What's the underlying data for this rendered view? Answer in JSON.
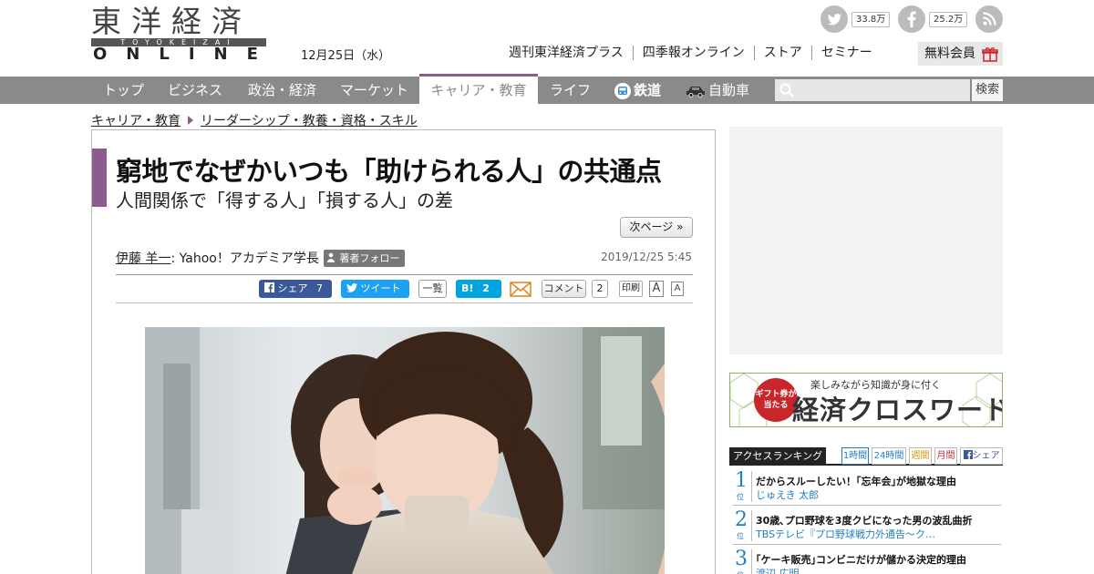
{
  "header": {
    "logo_kanji": "東洋経済",
    "logo_roman": "TOYOKEIZAI",
    "logo_online": "ONLINE",
    "date": "12月25日（水）",
    "links": [
      "週刊東洋経済プラス",
      "四季報オンライン",
      "ストア",
      "セミナー"
    ],
    "free_member": "無料会員",
    "social": {
      "twitter_count": "33.8万",
      "facebook_count": "25.2万"
    }
  },
  "nav": {
    "items": [
      "トップ",
      "ビジネス",
      "政治・経済",
      "マーケット",
      "キャリア・教育",
      "ライフ",
      "鉄道",
      "自動車"
    ],
    "active": "キャリア・教育",
    "search_button": "検索",
    "search_placeholder": ""
  },
  "breadcrumb": [
    "キャリア・教育",
    "リーダーシップ・教養・資格・スキル"
  ],
  "article": {
    "title": "窮地でなぜかいつも「助けられる人」の共通点",
    "subtitle": "人間関係で「得する人」「損する人」の差",
    "next_page": "次ページ »",
    "author": "伊藤 羊一",
    "author_affiliation": " : Yahoo！アカデミア学長",
    "follow": "著者フォロー",
    "published": "2019/12/25 5:45",
    "share": {
      "facebook": "シェア",
      "facebook_count": "7",
      "tweet": "ツイート",
      "tweet_list": "一覧",
      "hatena": "B!",
      "hatena_count": "2",
      "comment": "コメント",
      "comment_count": "2",
      "print": "印刷",
      "font_large": "A",
      "font_small": "A"
    }
  },
  "sidebar": {
    "banner": {
      "badge": "ギフト券が当たる",
      "tagline": "楽しみながら知識が身に付く",
      "title": "経済クロスワード"
    },
    "ranking": {
      "heading": "アクセスランキング",
      "tabs": [
        "1時間",
        "24時間",
        "週間",
        "月間",
        "シェア"
      ],
      "items": [
        {
          "rank": "1",
          "title": "だからスルーしたい！｢忘年会｣が地獄な理由",
          "author": "じゅえき 太郎"
        },
        {
          "rank": "2",
          "title": "30歳､プロ野球を3度クビになった男の波乱曲折",
          "author": "TBSテレビ『プロ野球戦力外通告～ク…"
        },
        {
          "rank": "3",
          "title": "｢ケーキ販売｣コンビニだけが儲かる決定的理由",
          "author": "渡辺 広明"
        }
      ],
      "rank_suffix": "位"
    }
  },
  "colors": {
    "accent_purple": "#8d5b8e",
    "nav_gray": "#8a8a8a",
    "link_blue": "#1e7fc4",
    "facebook": "#3b5998",
    "twitter": "#1da1f2",
    "hatena": "#00a4de"
  }
}
